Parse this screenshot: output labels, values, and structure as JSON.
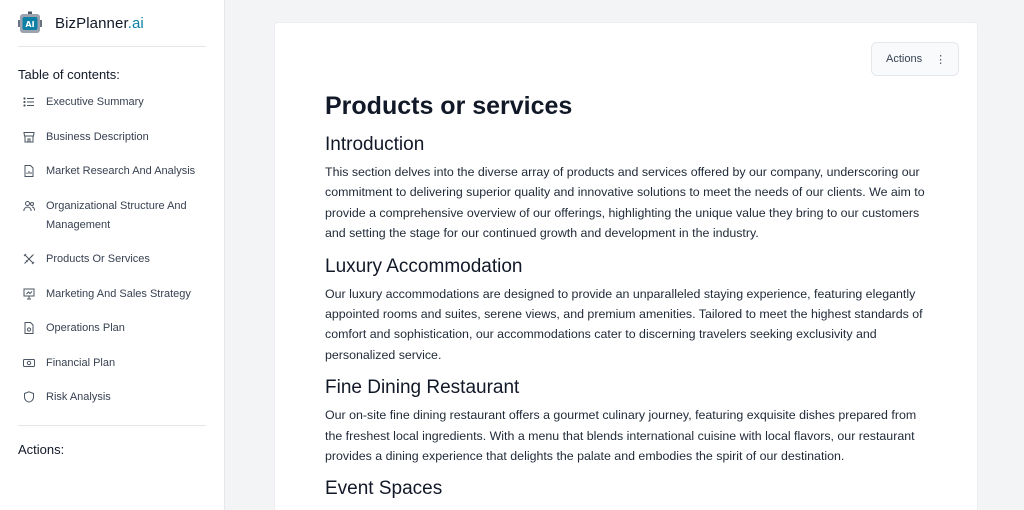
{
  "brand": {
    "name": "BizPlanner",
    "suffix": ".ai"
  },
  "sidebar": {
    "toc_title": "Table of contents:",
    "items": [
      {
        "label": "Executive Summary",
        "icon": "list-icon"
      },
      {
        "label": "Business Description",
        "icon": "store-icon"
      },
      {
        "label": "Market Research And Analysis",
        "icon": "document-chart-icon"
      },
      {
        "label": "Organizational Structure And Management",
        "icon": "users-icon"
      },
      {
        "label": "Products Or Services",
        "icon": "tools-icon"
      },
      {
        "label": "Marketing And Sales Strategy",
        "icon": "presentation-icon"
      },
      {
        "label": "Operations Plan",
        "icon": "document-gear-icon"
      },
      {
        "label": "Financial Plan",
        "icon": "money-icon"
      },
      {
        "label": "Risk Analysis",
        "icon": "shield-icon"
      }
    ],
    "actions_title": "Actions:"
  },
  "main": {
    "actions_label": "Actions",
    "actions_icon": "⋮",
    "page_title": "Products or services",
    "sections": [
      {
        "heading": "Introduction",
        "body": "This section delves into the diverse array of products and services offered by our company, underscoring our commitment to delivering superior quality and innovative solutions to meet the needs of our clients. We aim to provide a comprehensive overview of our offerings, highlighting the unique value they bring to our customers and setting the stage for our continued growth and development in the industry."
      },
      {
        "heading": "Luxury Accommodation",
        "body": "Our luxury accommodations are designed to provide an unparalleled staying experience, featuring elegantly appointed rooms and suites, serene views, and premium amenities. Tailored to meet the highest standards of comfort and sophistication, our accommodations cater to discerning travelers seeking exclusivity and personalized service."
      },
      {
        "heading": "Fine Dining Restaurant",
        "body": "Our on-site fine dining restaurant offers a gourmet culinary journey, featuring exquisite dishes prepared from the freshest local ingredients. With a menu that blends international cuisine with local flavors, our restaurant provides a dining experience that delights the palate and embodies the spirit of our destination."
      },
      {
        "heading": "Event Spaces",
        "body": ""
      }
    ]
  },
  "colors": {
    "accent": "#0e7fa6",
    "background": "#f3f4f6",
    "card": "#ffffff"
  }
}
